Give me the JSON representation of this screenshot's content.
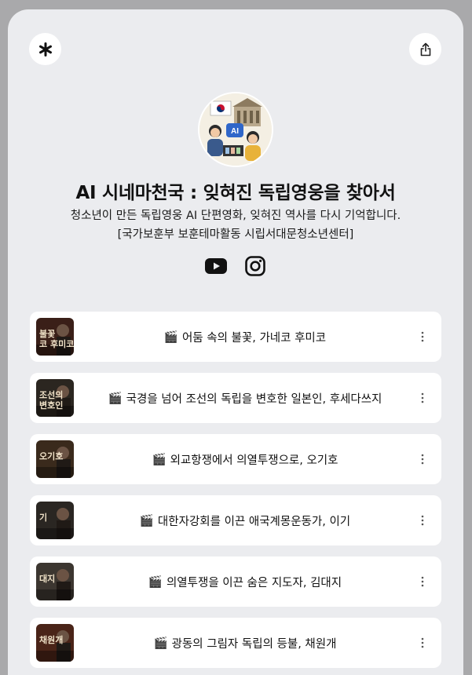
{
  "profile": {
    "title": "AI 시네마천국 : 잊혀진 독립영웅을 찾아서",
    "description": "청소년이 만든 독립영웅 AI 단편영화, 잊혀진 역사를 다시 기억합니다. [국가보훈부 보훈테마활동 시립서대문청소년센터]",
    "avatar_badge": "AI"
  },
  "header": {
    "logo_icon": "asterisk-icon",
    "share_icon": "share-icon"
  },
  "socials": [
    {
      "name": "youtube",
      "icon": "youtube-icon"
    },
    {
      "name": "instagram",
      "icon": "instagram-icon"
    }
  ],
  "links": [
    {
      "emoji": "🎬",
      "label": "어둠 속의 불꽃, 가네코 후미코",
      "thumb_text": "불꽃\n코 후미코",
      "thumb_color": "#3a1f18"
    },
    {
      "emoji": "🎬",
      "label": "국경을 넘어 조선의 독립을 변호한 일본인, 후세다쓰지",
      "thumb_text": "조선의\n변호인",
      "thumb_color": "#2b2620"
    },
    {
      "emoji": "🎬",
      "label": "외교항쟁에서 의열투쟁으로, 오기호",
      "thumb_text": "오기호",
      "thumb_color": "#3a2a1c"
    },
    {
      "emoji": "🎬",
      "label": "대한자강회를 이끈 애국계몽운동가, 이기",
      "thumb_text": "기",
      "thumb_color": "#2a2622"
    },
    {
      "emoji": "🎬",
      "label": "의열투쟁을 이끈 숨은 지도자, 김대지",
      "thumb_text": "대지",
      "thumb_color": "#3c3630"
    },
    {
      "emoji": "🎬",
      "label": "광동의 그림자 독립의 등불, 채원개",
      "thumb_text": "채원개",
      "thumb_color": "#4a2418"
    }
  ],
  "colors": {
    "background": "#a9a9ab",
    "card": "#ebecef",
    "button": "#ffffff",
    "text": "#111111"
  }
}
